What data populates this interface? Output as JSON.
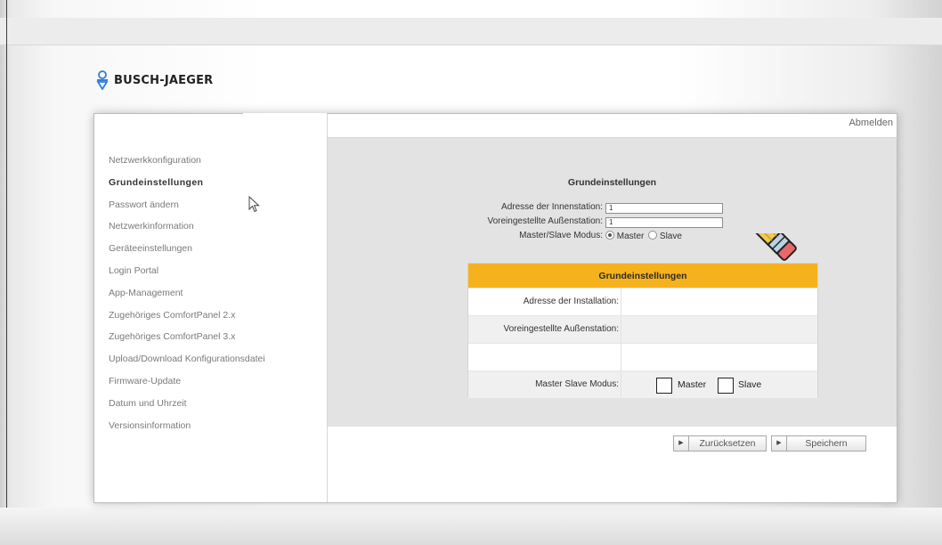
{
  "brand": {
    "name": "BUSCH-JAEGER"
  },
  "header": {
    "logout_label": "Abmelden"
  },
  "sidebar": {
    "items": [
      {
        "label": "Netzwerkkonfiguration"
      },
      {
        "label": "Grundeinstellungen",
        "active": true
      },
      {
        "label": "Passwort ändern"
      },
      {
        "label": "Netzwerkinformation"
      },
      {
        "label": "Geräteeinstellungen"
      },
      {
        "label": "Login Portal"
      },
      {
        "label": "App-Management"
      },
      {
        "label": "Zugehöriges ComfortPanel 2.x"
      },
      {
        "label": "Zugehöriges ComfortPanel 3.x"
      },
      {
        "label": "Upload/Download Konfigurationsdatei"
      },
      {
        "label": "Firmware-Update"
      },
      {
        "label": "Datum und Uhrzeit"
      },
      {
        "label": "Versionsinformation"
      }
    ]
  },
  "main": {
    "title": "Grundeinstellungen",
    "fields": {
      "indoor_label": "Adresse der Innenstation:",
      "indoor_value": "1",
      "outdoor_label": "Voreingestellte Außenstation:",
      "outdoor_value": "1",
      "mode_label": "Master/Slave Modus:",
      "master_label": "Master",
      "slave_label": "Slave",
      "selected_mode": "Master"
    },
    "overlay_card": {
      "title": "Grundeinstellungen",
      "row_install": "Adresse der Installation:",
      "row_outdoor": "Voreingestellte Außenstation:",
      "row_mode": "Master Slave Modus:",
      "master_label": "Master",
      "slave_label": "Slave"
    },
    "buttons": {
      "reset_label": "Zurücksetzen",
      "save_label": "Speichern"
    }
  },
  "colors": {
    "card_header": "#f5b21c",
    "content_bg": "#e3e3e3",
    "pencil_body": "#f2c94c",
    "pencil_eraser": "#e8676b"
  },
  "icons": [
    "busch-jaeger-logo-icon",
    "mouse-cursor-icon",
    "pencil-icon",
    "play-arrow-icon"
  ]
}
